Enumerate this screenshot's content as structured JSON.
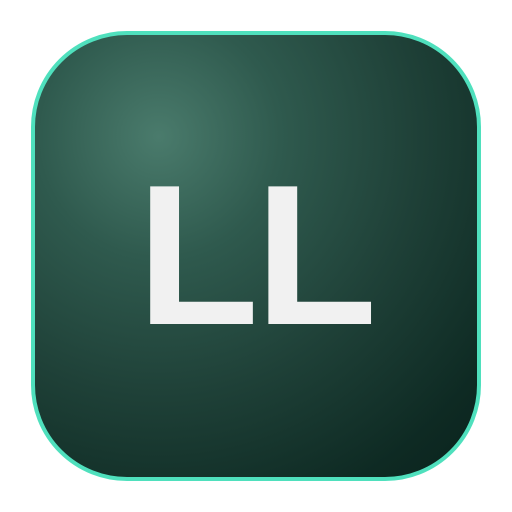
{
  "icon": {
    "letters": [
      "L",
      "L"
    ],
    "colors": {
      "border": "#4fe0bd",
      "background_highlight": "#4a7b6c",
      "background_dark": "#0a231d",
      "text": "#f1f1f1"
    }
  }
}
